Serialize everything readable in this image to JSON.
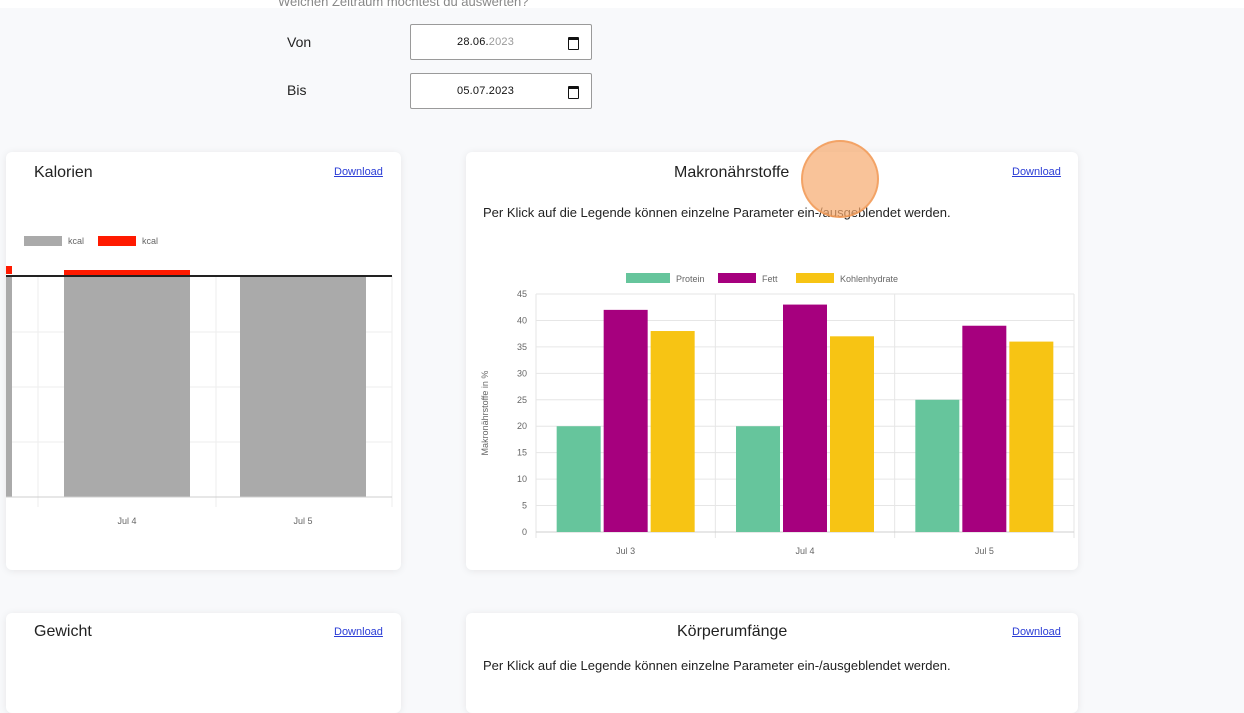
{
  "form": {
    "question": "Welchen Zeitraum möchtest du auswerten?",
    "from_label": "Von",
    "from_value_day_month": "28.06.",
    "from_value_year": "2023",
    "to_label": "Bis",
    "to_value": "05.07.2023"
  },
  "kalorien": {
    "title": "Kalorien",
    "download_label": "Download",
    "legend": [
      {
        "label": "kcal",
        "color": "#aaaaaa"
      },
      {
        "label": "kcal",
        "color": "#ff1a00"
      }
    ],
    "x_labels": [
      "Jul 4",
      "Jul 5"
    ]
  },
  "makro": {
    "title": "Makronährstoffe",
    "download_label": "Download",
    "hint": "Per Klick auf die Legende können einzelne Parameter ein-/ausgeblendet werden."
  },
  "gewicht": {
    "title": "Gewicht",
    "download_label": "Download"
  },
  "koerper": {
    "title": "Körperumfänge",
    "download_label": "Download",
    "hint": "Per Klick auf die Legende können einzelne Parameter ein-/ausgeblendet werden."
  },
  "chart_data": [
    {
      "type": "bar",
      "title": "Kalorien",
      "categories": [
        "Jul 4",
        "Jul 5"
      ],
      "series": [
        {
          "name": "kcal",
          "color": "#aaaaaa",
          "values": [
            100,
            100
          ]
        },
        {
          "name": "kcal",
          "color": "#ff1a00",
          "values": [
            2,
            0
          ]
        }
      ],
      "ylim": [
        0,
        100
      ],
      "target_line": 100,
      "grid": true
    },
    {
      "type": "bar",
      "title": "Makronährstoffe",
      "categories": [
        "Jul 3",
        "Jul 4",
        "Jul 5"
      ],
      "series": [
        {
          "name": "Protein",
          "color": "#66c59c",
          "values": [
            20,
            20,
            25
          ]
        },
        {
          "name": "Fett",
          "color": "#a6007e",
          "values": [
            42,
            43,
            39
          ]
        },
        {
          "name": "Kohlenhydrate",
          "color": "#f7c414",
          "values": [
            38,
            37,
            36
          ]
        }
      ],
      "ylabel": "Makronährstoffe in %",
      "ylim": [
        0,
        45
      ],
      "yticks": [
        0,
        5,
        10,
        15,
        20,
        25,
        30,
        35,
        40,
        45
      ],
      "grid": true,
      "legend_position": "top"
    }
  ]
}
